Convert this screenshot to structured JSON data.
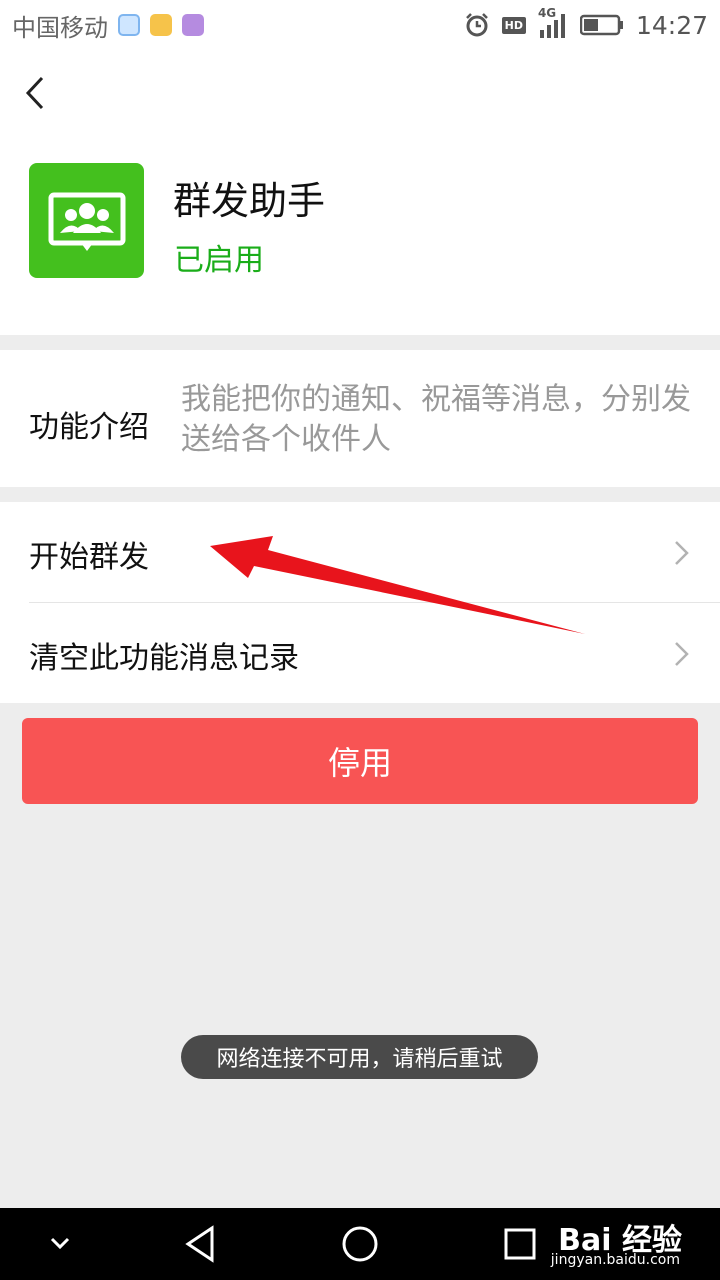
{
  "status_bar": {
    "carrier": "中国移动",
    "time": "14:27",
    "network": "4G",
    "hd": "HD"
  },
  "app": {
    "name": "群发助手",
    "status": "已启用"
  },
  "intro": {
    "label": "功能介绍",
    "text": "我能把你的通知、祝福等消息，分别发送给各个收件人"
  },
  "menu": {
    "items": [
      {
        "label": "开始群发"
      },
      {
        "label": "清空此功能消息记录"
      }
    ]
  },
  "actions": {
    "disable_label": "停用"
  },
  "toast": {
    "message": "网络连接不可用，请稍后重试"
  },
  "watermark": {
    "brand": "Bai 经验",
    "url": "jingyan.baidu.com"
  },
  "colors": {
    "accent_green": "#1aad19",
    "icon_green": "#44c01e",
    "danger": "#f85454",
    "annotation_arrow": "#e8141c"
  },
  "icons": {
    "back": "chevron-left-icon",
    "app": "group-chat-icon",
    "row_chevron": "chevron-right-icon",
    "nav_down": "chevron-down-icon",
    "nav_back": "triangle-back-icon",
    "nav_home": "circle-home-icon",
    "nav_recent": "square-recent-icon"
  }
}
